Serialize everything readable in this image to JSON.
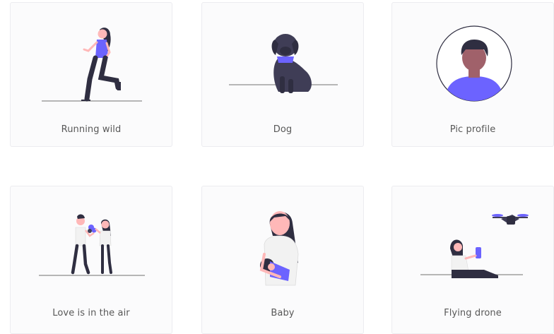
{
  "cards": [
    {
      "title": "Running wild",
      "illustration": "running-woman-illustration"
    },
    {
      "title": "Dog",
      "illustration": "dog-illustration"
    },
    {
      "title": "Pic profile",
      "illustration": "profile-avatar-illustration"
    },
    {
      "title": "Love is in the air",
      "illustration": "couple-flowers-illustration"
    },
    {
      "title": "Baby",
      "illustration": "mother-baby-illustration"
    },
    {
      "title": "Flying drone",
      "illustration": "drone-pilot-illustration"
    }
  ],
  "colors": {
    "accent": "#6c63ff",
    "dark": "#2f2e41",
    "skin": "#ffb8b8",
    "skin_dark": "#a0616a",
    "light": "#f2f2f2",
    "ground": "#a0a0a0"
  }
}
